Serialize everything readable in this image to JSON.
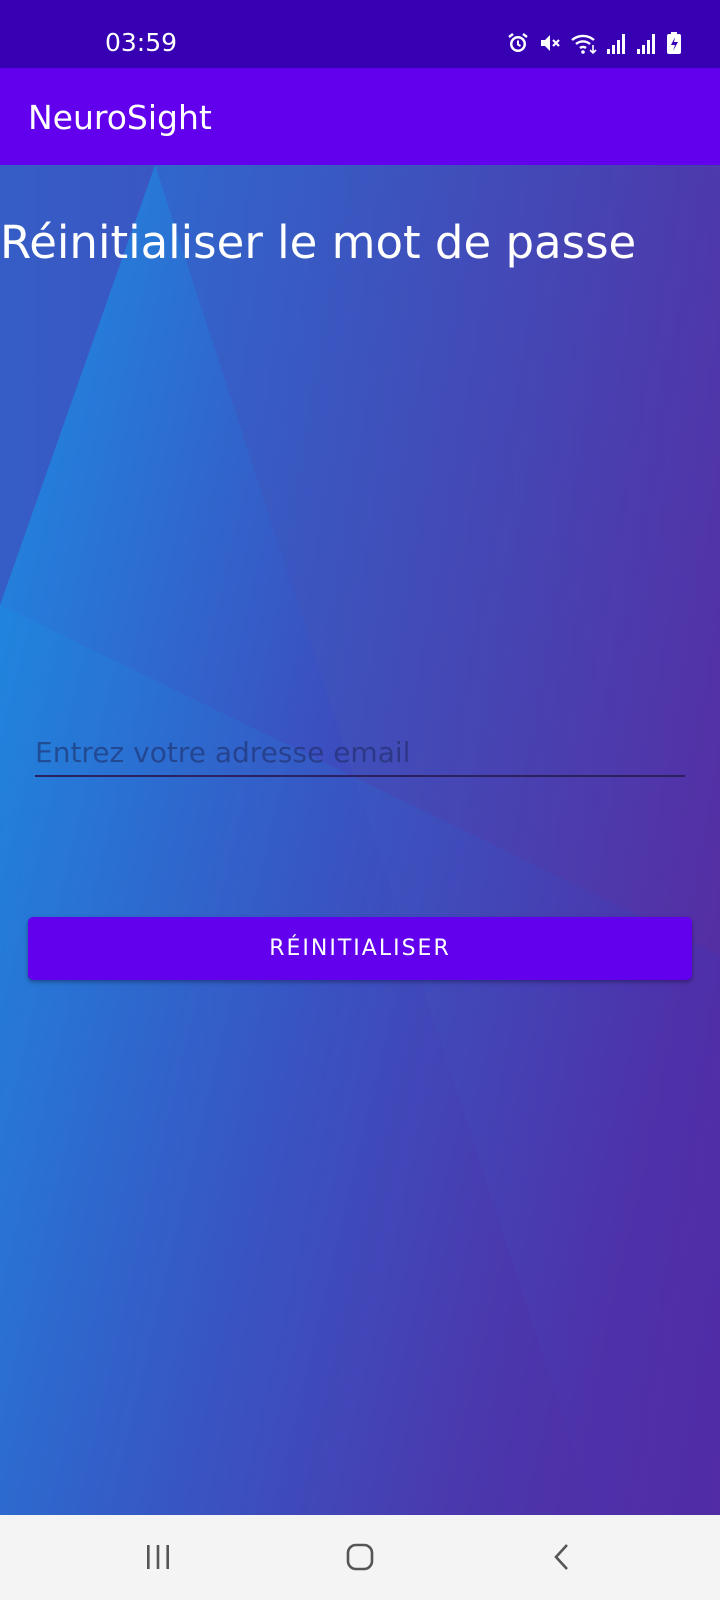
{
  "status_bar": {
    "time": "03:59",
    "icons": [
      "alarm-icon",
      "mute-icon",
      "wifi-icon",
      "signal-icon",
      "signal-icon",
      "battery-charging-icon"
    ]
  },
  "app_bar": {
    "title": "NeuroSight"
  },
  "main": {
    "title": "Réinitialiser le mot de passe",
    "email_input": {
      "placeholder": "Entrez votre adresse email",
      "value": ""
    },
    "reset_button_label": "RÉINITIALISER"
  },
  "nav_bar": {
    "items": [
      "recent-apps-icon",
      "home-icon",
      "back-icon"
    ]
  },
  "colors": {
    "status_bar": "#3700b3",
    "app_bar": "#6200ee",
    "button": "#6200ee",
    "gradient_light": "#1a8fe3",
    "gradient_dark": "#5a22a0"
  }
}
